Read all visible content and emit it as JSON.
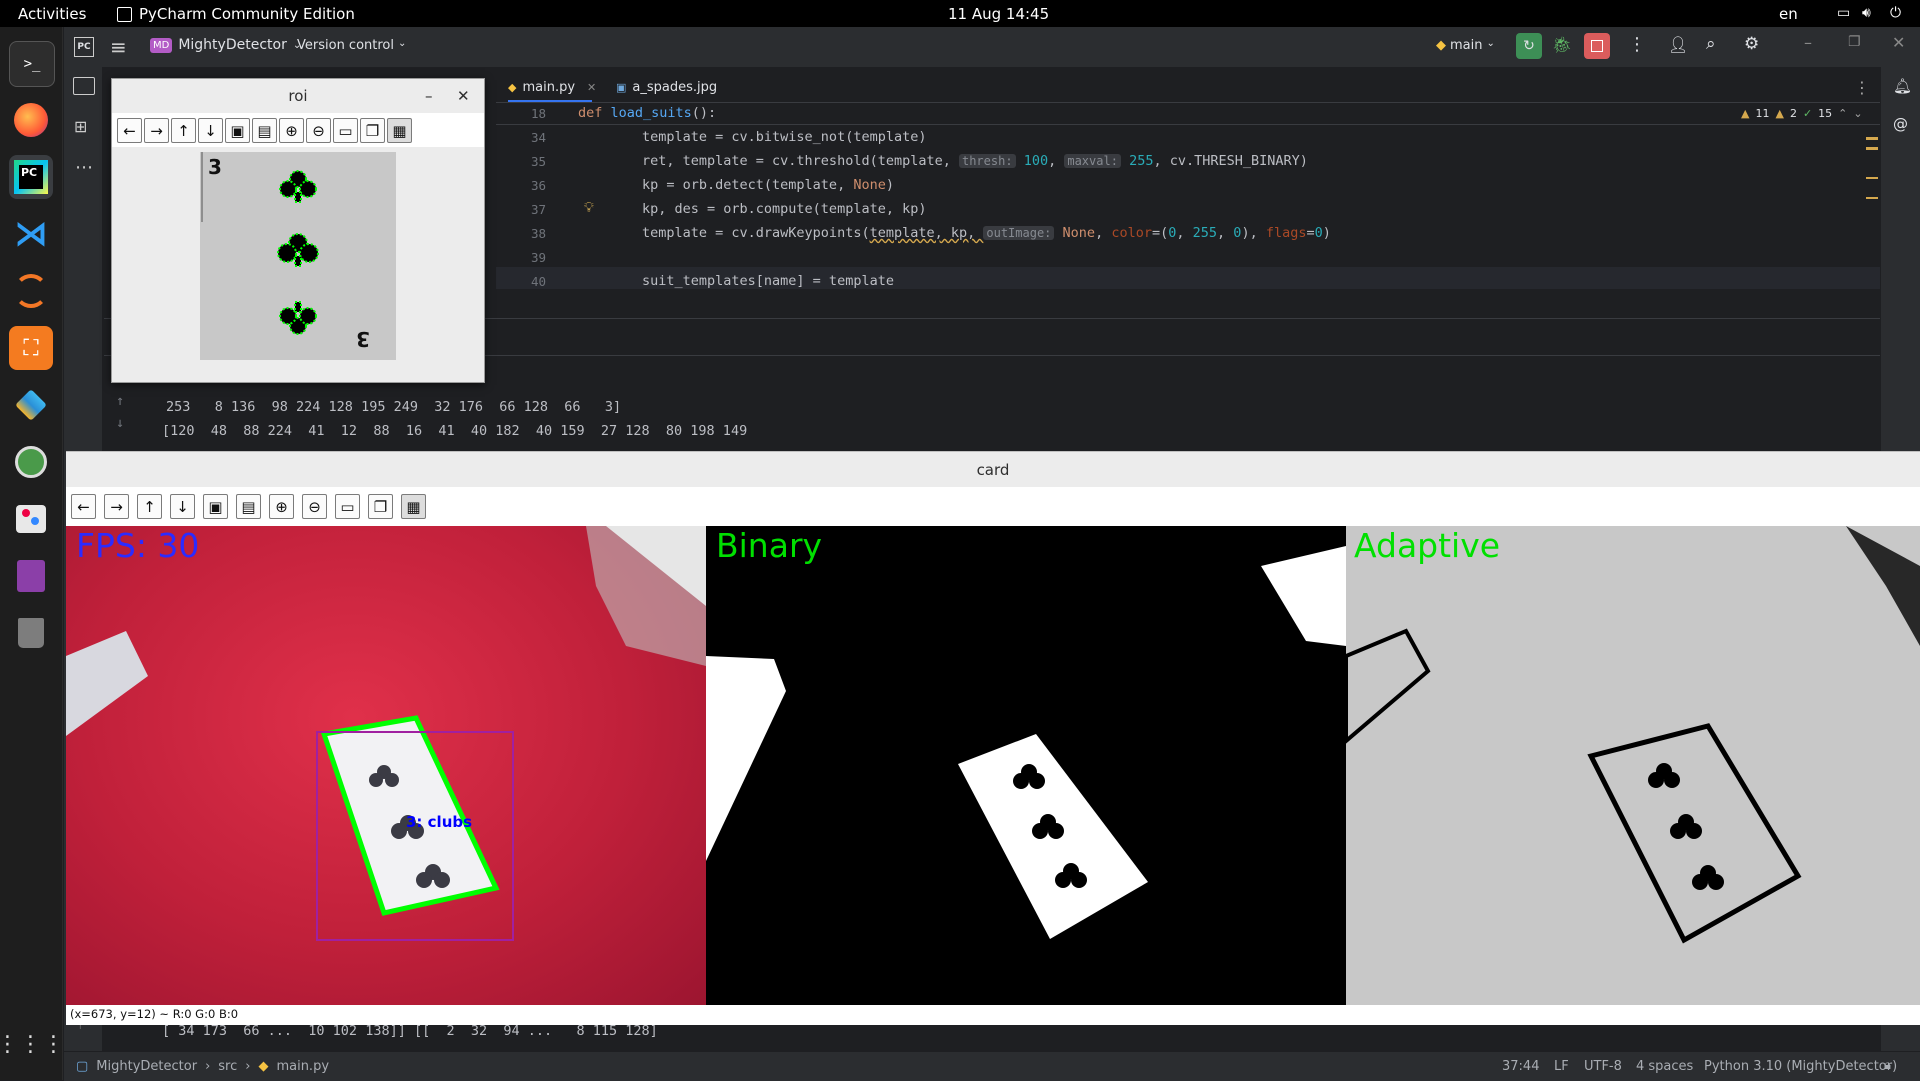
{
  "topbar": {
    "activities": "Activities",
    "app_name": "PyCharm Community Edition",
    "clock": "11 Aug  14:45",
    "language": "en"
  },
  "ide": {
    "project_badge": "MD",
    "project_name": "MightyDetector",
    "vcs_label": "Version control",
    "branch": "main",
    "tabs": [
      {
        "label": "main.py"
      },
      {
        "label": "a_spades.jpg"
      }
    ],
    "inspections": {
      "warnings": "11",
      "weak": "2",
      "ok": "15"
    },
    "editor_lines": [
      {
        "num": "18",
        "text": "def load_suits():"
      },
      {
        "num": "34",
        "text": "template = cv.bitwise_not(template)"
      },
      {
        "num": "35",
        "text": "ret, template = cv.threshold(template, thresh: 100, maxval: 255, cv.THRESH_BINARY)"
      },
      {
        "num": "36",
        "text": "kp = orb.detect(template, None)"
      },
      {
        "num": "37",
        "text": "kp, des = orb.compute(template, kp)"
      },
      {
        "num": "38",
        "text": "template = cv.drawKeypoints(template, kp, outImage: None, color=(0, 255, 0), flags=0)"
      },
      {
        "num": "39",
        "text": ""
      },
      {
        "num": "40",
        "text": "suit_templates[name] = template"
      }
    ],
    "hints": {
      "thresh": "thresh:",
      "maxval": "maxval:",
      "outimage": "outImage:"
    },
    "run_output": [
      "253   8 136  98 224 128 195 249  32 176  66 128  66   3]",
      "[120  48  88 224  41  12  88  16  41  40 182  40 159  27 128  80 198 149",
      "[ 34 173  66 ...  10 102 138]] [[  2  32  94 ...   8 115 128]"
    ],
    "status": {
      "breadcrumb": [
        "MightyDetector",
        "src",
        "main.py"
      ],
      "position": "37:44",
      "line_sep": "LF",
      "encoding": "UTF-8",
      "indent": "4 spaces",
      "interpreter": "Python 3.10 (MightyDetector)"
    }
  },
  "roi_window": {
    "title": "roi",
    "toolbar": [
      "arrow-left-icon",
      "arrow-right-icon",
      "arrow-up-icon",
      "arrow-down-icon",
      "image-icon",
      "image-settings-icon",
      "zoom-in-icon",
      "zoom-out-icon",
      "save-icon",
      "copy-icon",
      "properties-icon"
    ]
  },
  "card_window": {
    "title": "card",
    "status": "(x=673, y=12) ~ R:0 G:0 B:0",
    "overlays": {
      "fps": "FPS: 30",
      "binary": "Binary",
      "adaptive": "Adaptive",
      "detection": "3: clubs"
    },
    "colors": {
      "fps": "#2b2bff",
      "panel_label": "#00e000",
      "box": "#a020a0",
      "card_outline": "#00ff00",
      "r": "#ff0000",
      "g": "#00b000",
      "b": "#0000ff"
    }
  }
}
